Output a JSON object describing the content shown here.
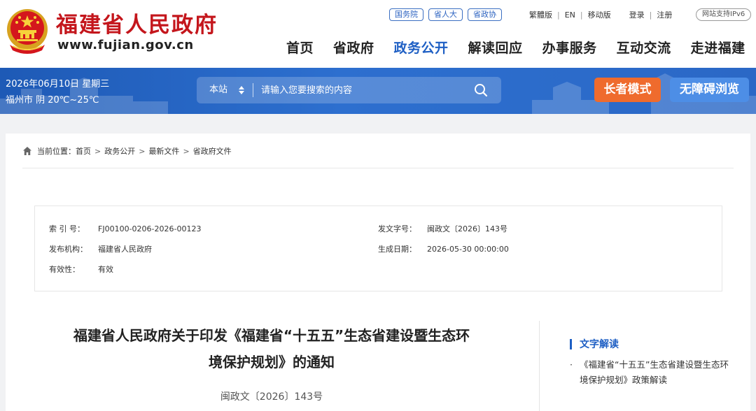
{
  "header": {
    "site_title": "福建省人民政府",
    "site_url": "www.fujian.gov.cn",
    "top_pills": [
      "国务院",
      "省人大",
      "省政协"
    ],
    "top_links": {
      "traditional": "繁體版",
      "english": "EN",
      "mobile": "移动版",
      "login": "登录",
      "register": "注册"
    },
    "ipv6": "网站支持IPv6",
    "nav": [
      {
        "label": "首页",
        "active": false
      },
      {
        "label": "省政府",
        "active": false
      },
      {
        "label": "政务公开",
        "active": true
      },
      {
        "label": "解读回应",
        "active": false
      },
      {
        "label": "办事服务",
        "active": false
      },
      {
        "label": "互动交流",
        "active": false
      },
      {
        "label": "走进福建",
        "active": false
      }
    ],
    "colors": {
      "brand_red": "#c4161c",
      "accent_blue": "#1e5fc4"
    }
  },
  "infobar": {
    "date": "2026年06月10日 星期三",
    "weather": "福州市 阴 20℃~25℃",
    "search": {
      "scope": "本站",
      "placeholder": "请输入您要搜索的内容",
      "icon": "search-icon"
    },
    "elder_mode": "长者模式",
    "accessible": "无障碍浏览",
    "colors": {
      "bar": "#2b68c6",
      "elder_button": "#ef6b2d",
      "access_button": "#4d8ee6"
    }
  },
  "breadcrumb": {
    "prefix": "当前位置：",
    "items": [
      "首页",
      "政务公开",
      "最新文件",
      "省政府文件"
    ],
    "separator": ">"
  },
  "meta": {
    "index_label": "索 引 号：",
    "index_value": "FJ00100-0206-2026-00123",
    "doc_no_label": "发文字号：",
    "doc_no_value": "闽政文〔2026〕143号",
    "issuer_label": "发布机构：",
    "issuer_value": "福建省人民政府",
    "date_label": "生成日期：",
    "date_value": "2026-05-30 00:00:00",
    "validity_label": "有效性：",
    "validity_value": "有效"
  },
  "article": {
    "title_line1": "福建省人民政府关于印发《福建省“十五五”生态省建设暨生态环",
    "title_line2": "境保护规划》的通知",
    "doc_number": "闽政文〔2026〕143号"
  },
  "sidebar": {
    "heading": "文字解读",
    "bullet": "·",
    "link": "《福建省“十五五”生态省建设暨生态环境保护规划》政策解读"
  }
}
